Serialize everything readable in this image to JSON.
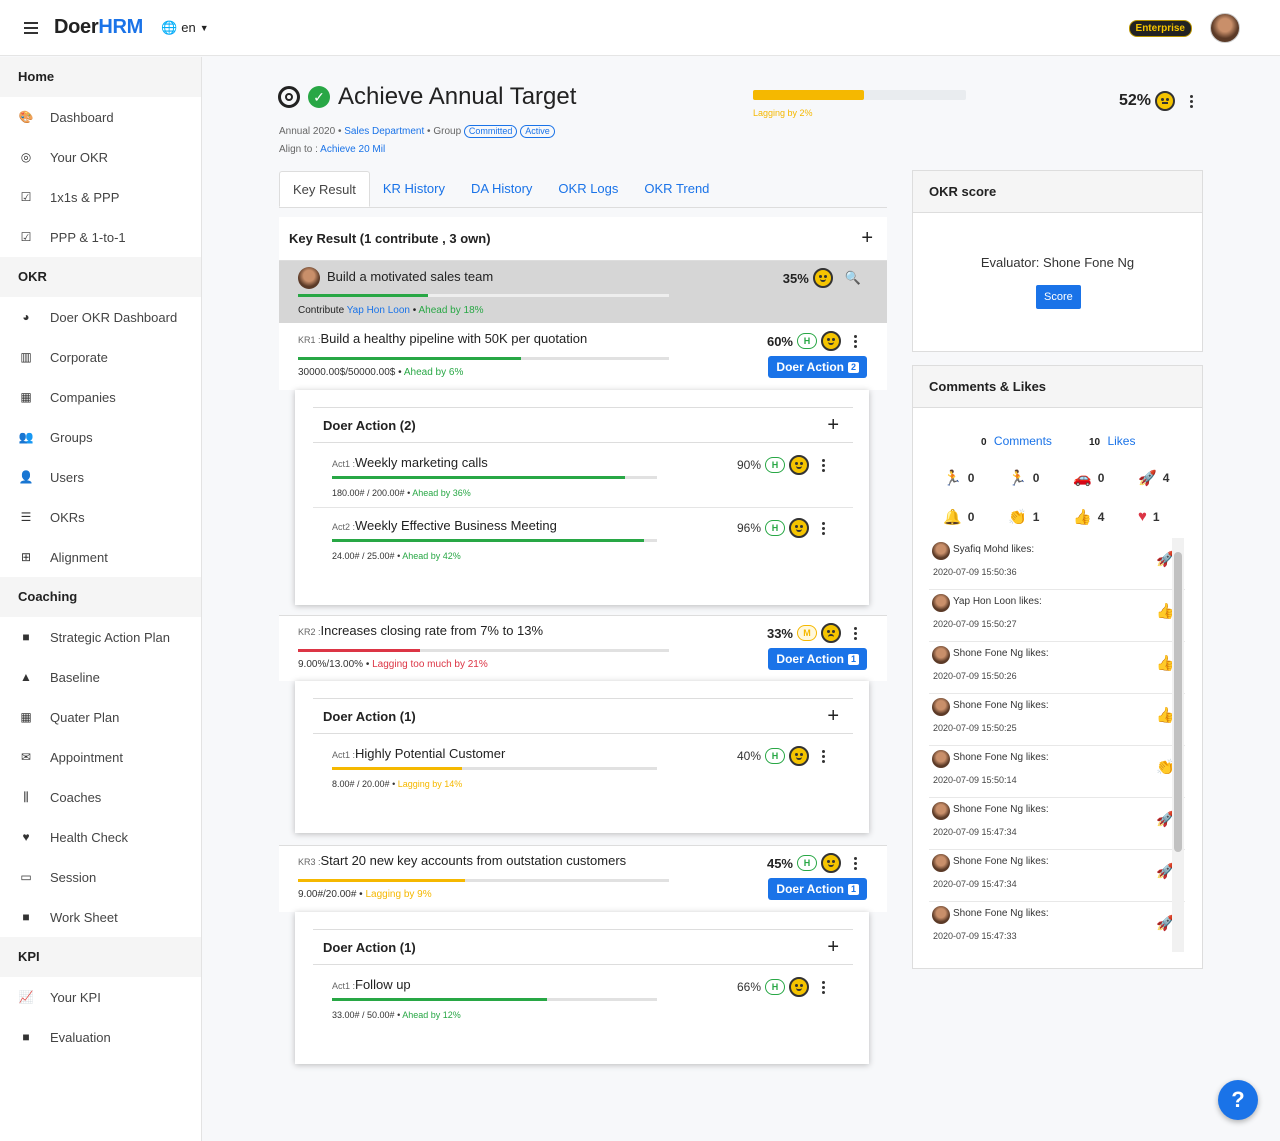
{
  "topbar": {
    "logo_pre": "Doer",
    "logo_post": "HRM",
    "lang": "en",
    "plan": "Enterprise"
  },
  "sidebar": {
    "sections": [
      {
        "title": "Home",
        "items": [
          {
            "label": "Dashboard",
            "icon": "palette-icon"
          },
          {
            "label": "Your OKR",
            "icon": "target-icon"
          },
          {
            "label": "1x1s & PPP",
            "icon": "calendar-check-icon"
          },
          {
            "label": "PPP & 1-to-1",
            "icon": "calendar-check-icon"
          }
        ]
      },
      {
        "title": "OKR",
        "items": [
          {
            "label": "Doer OKR Dashboard",
            "icon": "pie-chart-icon"
          },
          {
            "label": "Corporate",
            "icon": "city-icon"
          },
          {
            "label": "Companies",
            "icon": "building-icon"
          },
          {
            "label": "Groups",
            "icon": "users-group-icon"
          },
          {
            "label": "Users",
            "icon": "user-icon"
          },
          {
            "label": "OKRs",
            "icon": "list-icon"
          },
          {
            "label": "Alignment",
            "icon": "sitemap-icon"
          }
        ]
      },
      {
        "title": "Coaching",
        "items": [
          {
            "label": "Strategic Action Plan",
            "icon": "book-icon"
          },
          {
            "label": "Baseline",
            "icon": "road-icon"
          },
          {
            "label": "Quater Plan",
            "icon": "calendar-icon"
          },
          {
            "label": "Appointment",
            "icon": "envelope-icon"
          },
          {
            "label": "Coaches",
            "icon": "dumbbell-icon"
          },
          {
            "label": "Health Check",
            "icon": "heartbeat-icon"
          },
          {
            "label": "Session",
            "icon": "chalkboard-icon"
          },
          {
            "label": "Work Sheet",
            "icon": "book-icon"
          }
        ]
      },
      {
        "title": "KPI",
        "items": [
          {
            "label": "Your KPI",
            "icon": "line-chart-icon"
          },
          {
            "label": "Evaluation",
            "icon": "book-icon"
          }
        ]
      }
    ]
  },
  "header": {
    "title": "Achieve Annual Target",
    "period": "Annual 2020",
    "department": "Sales Department",
    "group_label": "Group",
    "badge_committed": "Committed",
    "badge_active": "Active",
    "align_label": "Align to :",
    "align_value": "Achieve 20 Mil",
    "progress": 0.52,
    "progress_status": "Lagging by 2%",
    "percent": "52%"
  },
  "tabs": [
    "Key Result",
    "KR History",
    "DA History",
    "OKR Logs",
    "OKR Trend"
  ],
  "key_result": {
    "heading": "Key Result (1 contribute , 3 own)",
    "objective": {
      "title": "Build a motivated sales team",
      "percent": "35%",
      "progress": 0.35,
      "contribute_label": "Contribute",
      "contributor": "Yap Hon Loon",
      "status": "Ahead by 18%"
    },
    "krs": [
      {
        "code": "KR1 :",
        "title": "Build a healthy pipeline with 50K per quotation",
        "percent": "60%",
        "progress": 0.6,
        "badge": "H",
        "meta": "30000.00$/50000.00$",
        "status": "Ahead by 6%",
        "status_color": "#28a745",
        "btn_label": "Doer Action",
        "btn_count": "2",
        "card_title": "Doer Action (2)",
        "acts": [
          {
            "code": "Act1 :",
            "title": "Weekly marketing calls",
            "percent": "90%",
            "badge": "H",
            "progress": 0.9,
            "meta": "180.00# / 200.00#",
            "status": "Ahead by 36%",
            "color": "#28a745"
          },
          {
            "code": "Act2 :",
            "title": "Weekly Effective Business Meeting",
            "percent": "96%",
            "badge": "H",
            "progress": 0.96,
            "meta": "24.00# / 25.00#",
            "status": "Ahead by 42%",
            "color": "#28a745"
          }
        ]
      },
      {
        "code": "KR2 :",
        "title": "Increases closing rate from 7% to 13%",
        "percent": "33%",
        "progress": 0.33,
        "badge": "M",
        "meta": "9.00%/13.00%",
        "status": "Lagging too much by 21%",
        "status_color": "#dc3545",
        "btn_label": "Doer Action",
        "btn_count": "1",
        "card_title": "Doer Action (1)",
        "acts": [
          {
            "code": "Act1 :",
            "title": "Highly Potential Customer",
            "percent": "40%",
            "badge": "H",
            "progress": 0.4,
            "meta": "8.00# / 20.00#",
            "status": "Lagging by 14%",
            "color": "#f5b800"
          }
        ]
      },
      {
        "code": "KR3 :",
        "title": "Start 20 new key accounts from outstation customers",
        "percent": "45%",
        "progress": 0.45,
        "badge": "H",
        "meta": "9.00#/20.00#",
        "status": "Lagging by 9%",
        "status_color": "#f5b800",
        "btn_label": "Doer Action",
        "btn_count": "1",
        "card_title": "Doer Action (1)",
        "acts": [
          {
            "code": "Act1 :",
            "title": "Follow up",
            "percent": "66%",
            "badge": "H",
            "progress": 0.66,
            "meta": "33.00# / 50.00#",
            "status": "Ahead by 12%",
            "color": "#28a745"
          }
        ]
      }
    ]
  },
  "okr_score": {
    "title": "OKR score",
    "evaluator": "Evaluator: Shone Fone Ng",
    "button": "Score"
  },
  "comments": {
    "title": "Comments & Likes",
    "comments_count": "0",
    "comments_label": "Comments",
    "likes_count": "10",
    "likes_label": "Likes",
    "reactions": [
      {
        "icon": "runner-icon",
        "sym": "🏃",
        "count": "0",
        "color": "#dc3545"
      },
      {
        "icon": "running-yellow-icon",
        "sym": "🏃",
        "count": "0",
        "color": "#f5b800"
      },
      {
        "icon": "car-icon",
        "sym": "🚗",
        "count": "0",
        "color": "#1a73e8"
      },
      {
        "icon": "rocket-icon",
        "sym": "🚀",
        "count": "4",
        "color": "#28a745"
      },
      {
        "icon": "bell-icon",
        "sym": "🔔",
        "count": "0",
        "color": "#dc3545"
      },
      {
        "icon": "clap-icon",
        "sym": "👏",
        "count": "1",
        "color": "#f5b800"
      },
      {
        "icon": "thumbs-up-icon",
        "sym": "👍",
        "count": "4",
        "color": "#1a73e8"
      },
      {
        "icon": "heart-icon",
        "sym": "♥",
        "count": "1",
        "color": "#dc3545"
      }
    ],
    "likes": [
      {
        "who": "Syafiq Mohd likes:",
        "ts": "2020-07-09 15:50:36",
        "icon": "rocket-icon",
        "sym": "🚀",
        "color": "#28a745"
      },
      {
        "who": "Yap Hon Loon likes:",
        "ts": "2020-07-09 15:50:27",
        "icon": "thumbs-up-icon",
        "sym": "👍",
        "color": "#1a73e8"
      },
      {
        "who": "Shone Fone Ng likes:",
        "ts": "2020-07-09 15:50:26",
        "icon": "thumbs-up-icon",
        "sym": "👍",
        "color": "#1a73e8"
      },
      {
        "who": "Shone Fone Ng likes:",
        "ts": "2020-07-09 15:50:25",
        "icon": "thumbs-up-icon",
        "sym": "👍",
        "color": "#1a73e8"
      },
      {
        "who": "Shone Fone Ng likes:",
        "ts": "2020-07-09 15:50:14",
        "icon": "clap-icon",
        "sym": "👏",
        "color": "#f5b800"
      },
      {
        "who": "Shone Fone Ng likes:",
        "ts": "2020-07-09 15:47:34",
        "icon": "rocket-icon",
        "sym": "🚀",
        "color": "#28a745"
      },
      {
        "who": "Shone Fone Ng likes:",
        "ts": "2020-07-09 15:47:34",
        "icon": "rocket-icon",
        "sym": "🚀",
        "color": "#28a745"
      },
      {
        "who": "Shone Fone Ng likes:",
        "ts": "2020-07-09 15:47:33",
        "icon": "rocket-icon",
        "sym": "🚀",
        "color": "#28a745"
      }
    ]
  },
  "help": "?"
}
